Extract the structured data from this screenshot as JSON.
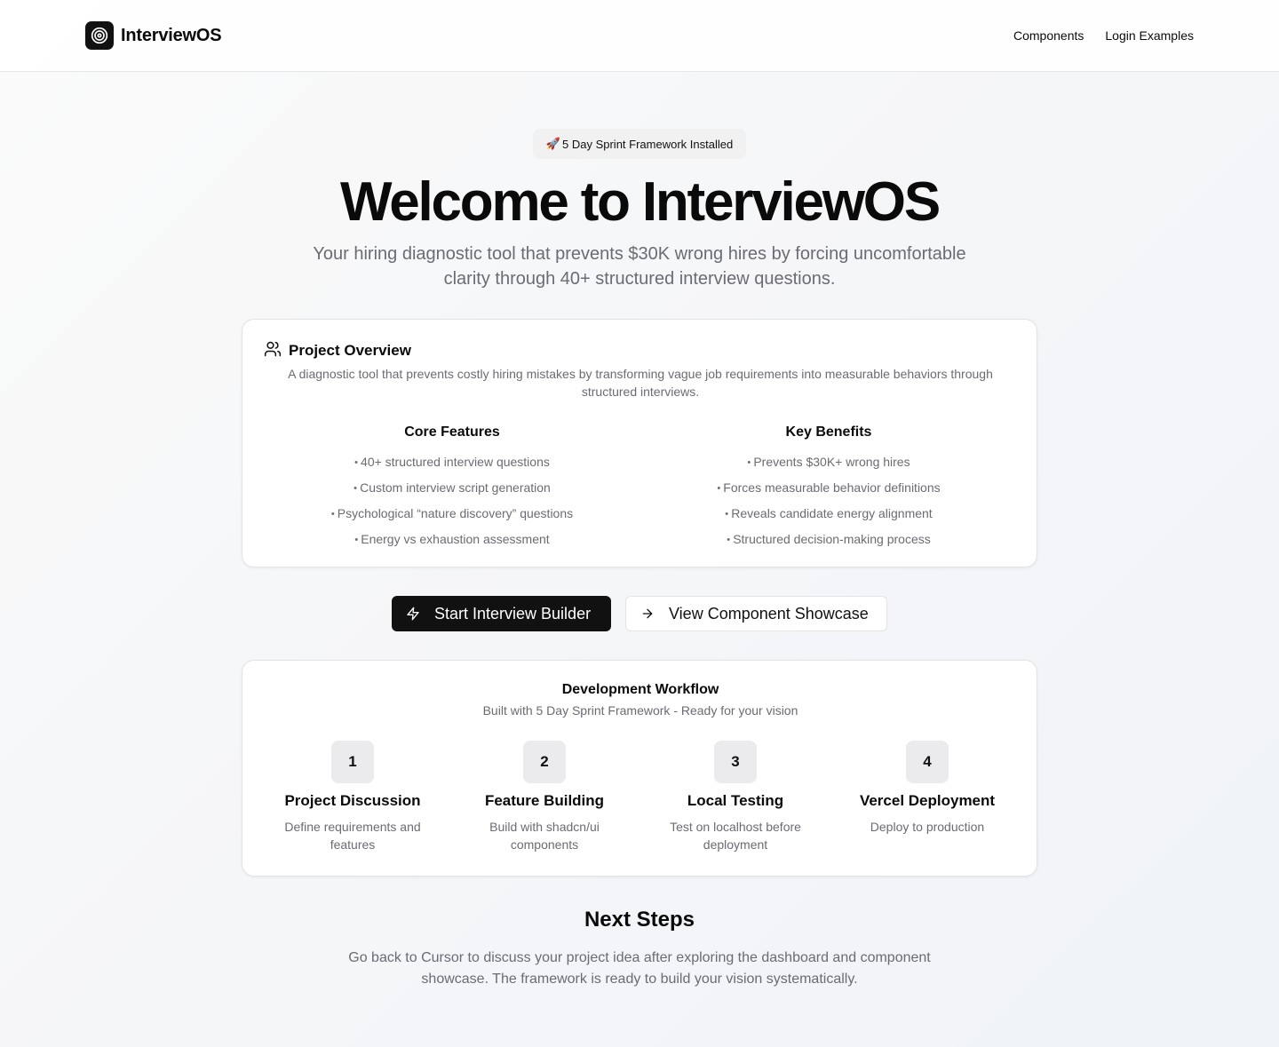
{
  "header": {
    "brand": "InterviewOS",
    "nav": [
      "Components",
      "Login Examples"
    ]
  },
  "hero": {
    "badge_icon": "🚀",
    "badge_text": "5 Day Sprint Framework Installed",
    "title": "Welcome to InterviewOS",
    "subtitle": "Your hiring diagnostic tool that prevents $30K wrong hires by forcing uncomfortable clarity through 40+ structured interview questions."
  },
  "overview": {
    "title": "Project Overview",
    "description": "A diagnostic tool that prevents costly hiring mistakes by transforming vague job requirements into measurable behaviors through structured interviews.",
    "core_features": {
      "heading": "Core Features",
      "items": [
        "40+ structured interview questions",
        "Custom interview script generation",
        "Psychological “nature discovery” questions",
        "Energy vs exhaustion assessment"
      ]
    },
    "key_benefits": {
      "heading": "Key Benefits",
      "items": [
        "Prevents $30K+ wrong hires",
        "Forces measurable behavior definitions",
        "Reveals candidate energy alignment",
        "Structured decision-making process"
      ]
    }
  },
  "actions": {
    "primary_label": "Start Interview Builder",
    "secondary_label": "View Component Showcase"
  },
  "workflow": {
    "title": "Development Workflow",
    "subtitle": "Built with 5 Day Sprint Framework - Ready for your vision",
    "steps": [
      {
        "num": "1",
        "title": "Project Discussion",
        "desc": "Define requirements and features"
      },
      {
        "num": "2",
        "title": "Feature Building",
        "desc": "Build with shadcn/ui components"
      },
      {
        "num": "3",
        "title": "Local Testing",
        "desc": "Test on localhost before deployment"
      },
      {
        "num": "4",
        "title": "Vercel Deployment",
        "desc": "Deploy to production"
      }
    ]
  },
  "next_steps": {
    "title": "Next Steps",
    "text": "Go back to Cursor to discuss your project idea after exploring the dashboard and component showcase. The framework is ready to build your vision systematically."
  },
  "icons": {
    "logo": "target-icon",
    "overview": "users-icon",
    "primary_button": "zap-icon",
    "secondary_button": "arrow-right-icon"
  },
  "colors": {
    "primary": "#111111",
    "muted_text": "#6b6b73",
    "border": "#e4e4e7"
  }
}
